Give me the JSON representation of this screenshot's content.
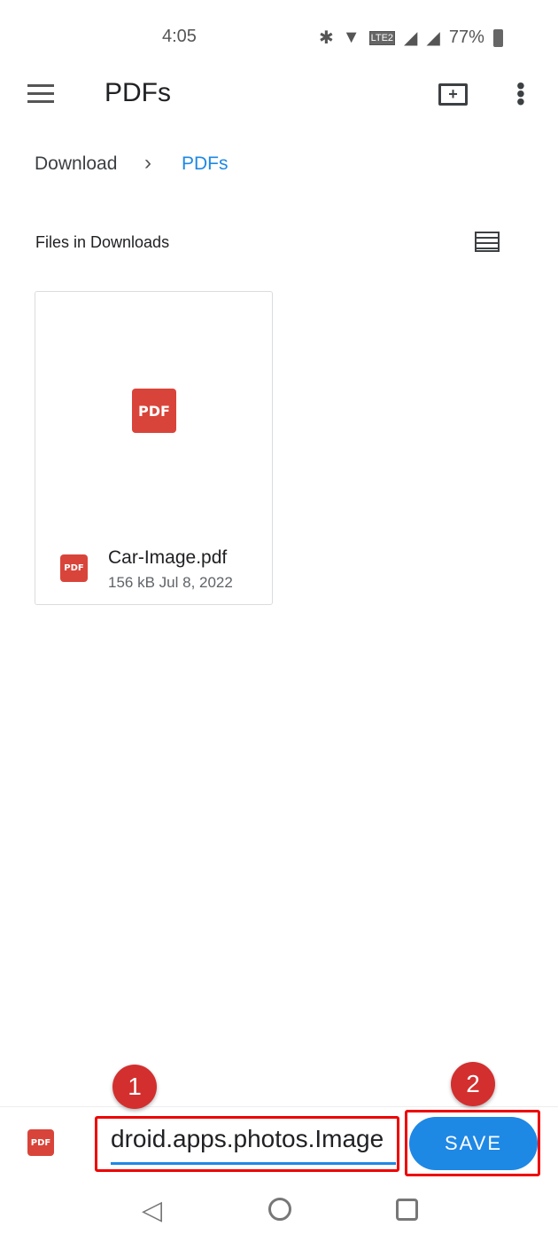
{
  "status_bar": {
    "time": "4:05",
    "battery": "77%",
    "icons": [
      "bluetooth-icon",
      "wifi-icon",
      "volte-icon",
      "signal-roaming-icon",
      "signal-icon",
      "battery-charging-icon"
    ]
  },
  "toolbar": {
    "title": "PDFs",
    "icons": [
      "menu-icon",
      "new-folder-icon",
      "more-vert-icon"
    ]
  },
  "breadcrumb": {
    "items": [
      "Download",
      "PDFs"
    ]
  },
  "section": {
    "title": "Files in Downloads"
  },
  "files": [
    {
      "name": "Car-Image.pdf",
      "size": "156 kB",
      "date": "Jul 8, 2022",
      "type_label": "PDF"
    }
  ],
  "save_bar": {
    "filename": "droid.apps.photos.Image",
    "save_label": "SAVE",
    "type_label": "PDF"
  },
  "annotations": [
    "1",
    "2"
  ],
  "colors": {
    "accent": "#1e88e5",
    "pdf": "#d9443a",
    "annotation": "#d32f2f"
  }
}
